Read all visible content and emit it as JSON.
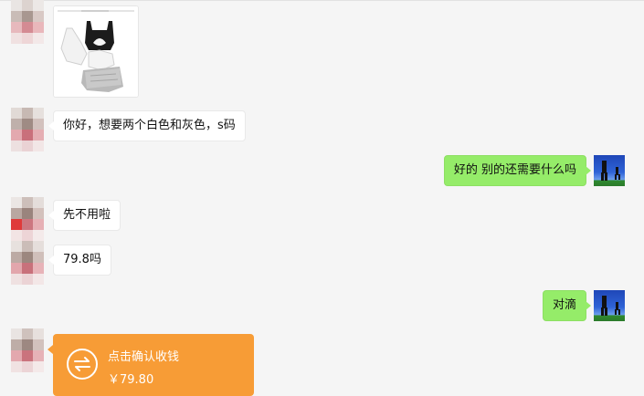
{
  "messages": {
    "greeting": "你好，想要两个白色和灰色，s码",
    "reply_ok": "好的  别的还需要什么吗",
    "no_more": "先不用啦",
    "price": "79.8吗",
    "confirm": "对滴"
  },
  "transfer": {
    "title": "点击确认收钱",
    "amount": "￥79.80"
  },
  "colors": {
    "my_bubble": "#95ec69",
    "transfer_card": "#f79c36",
    "background": "#f5f5f5"
  }
}
